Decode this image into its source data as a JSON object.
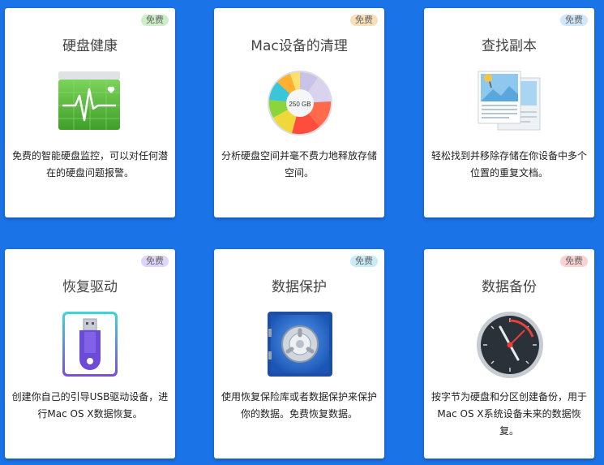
{
  "cards": [
    {
      "title": "硬盘健康",
      "badge": "免费",
      "badge_color": "#cdeec6",
      "desc": "免费的智能硬盘监控，可以对任何潜在的硬盘问题报警。",
      "icon": "disk-health-icon"
    },
    {
      "title": "Mac设备的清理",
      "badge": "免费",
      "badge_color": "#f7dfb8",
      "desc": "分析硬盘空间并毫不费力地释放存储空间。",
      "icon": "disk-space-pie-icon",
      "pie_label": "250 GB"
    },
    {
      "title": "查找副本",
      "badge": "免费",
      "badge_color": "#cfe6fb",
      "desc": "轻松找到并移除存储在你设备中多个位置的重复文档。",
      "icon": "duplicate-files-icon"
    },
    {
      "title": "恢复驱动",
      "badge": "免费",
      "badge_color": "#ddd6f7",
      "desc": "创建你自己的引导USB驱动设备，进行Mac OS X数据恢复。",
      "icon": "usb-drive-icon"
    },
    {
      "title": "数据保护",
      "badge": "免费",
      "badge_color": "#c8ecf7",
      "desc": "使用恢复保险库或者数据保护来保护你的数据。免费恢复数据。",
      "icon": "safe-vault-icon"
    },
    {
      "title": "数据备份",
      "badge": "免费",
      "badge_color": "#f9d3d3",
      "desc": "按字节为硬盘和分区创建备份，用于Mac OS X系统设备未来的数据恢复。",
      "icon": "backup-clock-icon"
    }
  ]
}
